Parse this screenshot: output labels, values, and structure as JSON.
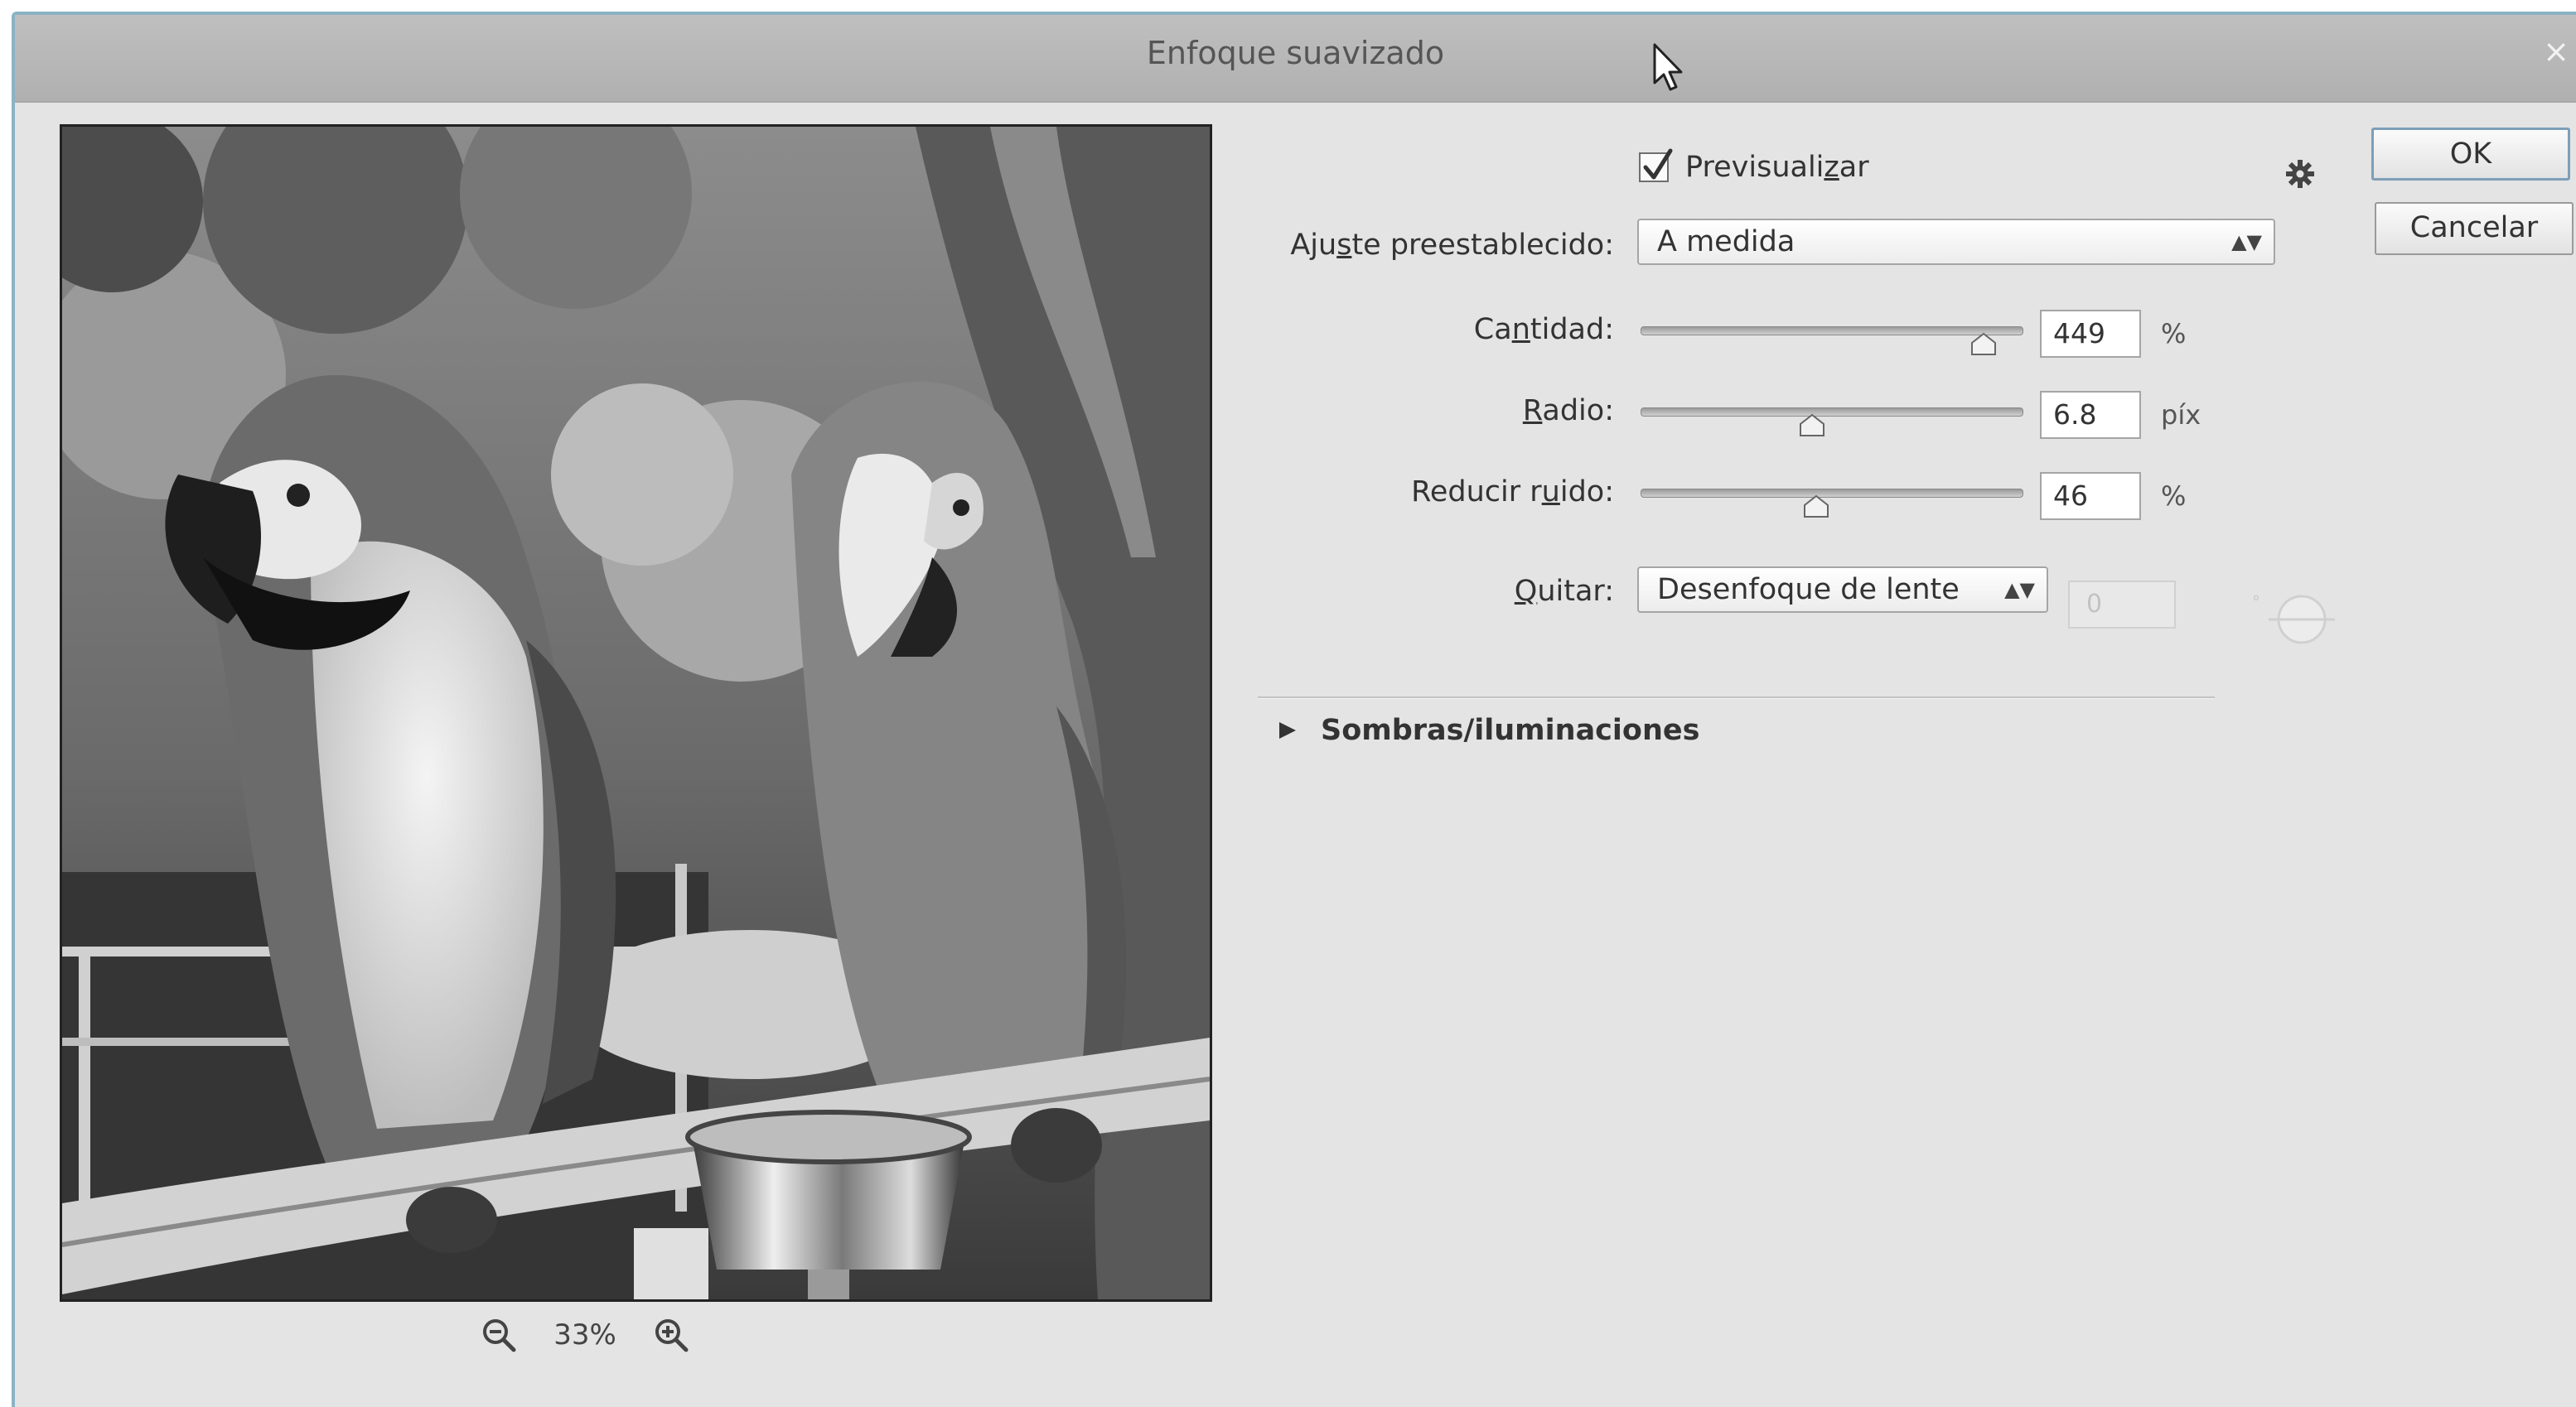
{
  "window": {
    "title": "Enfoque suavizado",
    "close_glyph": "×"
  },
  "preview": {
    "zoom_value": "33%",
    "zoom_out_icon": "zoom-out-magnifier-icon",
    "zoom_in_icon": "zoom-in-magnifier-icon"
  },
  "preview_checkbox": {
    "label_pre": "Previsuali",
    "label_u": "z",
    "label_post": "ar",
    "checked": true
  },
  "preset": {
    "label_pre": "Aju",
    "label_u": "s",
    "label_post": "te preestablecido:",
    "value": "A medida"
  },
  "amount": {
    "label_pre": "Ca",
    "label_u": "n",
    "label_post": "tidad:",
    "value": "449",
    "unit": "%",
    "slider_fraction": 0.9
  },
  "radius": {
    "label_pre": "",
    "label_u": "R",
    "label_post": "adio:",
    "value": "6.8",
    "unit": "píx",
    "slider_fraction": 0.45
  },
  "noise": {
    "label_pre": "Reducir r",
    "label_u": "u",
    "label_post": "ido:",
    "value": "46",
    "unit": "%",
    "slider_fraction": 0.46
  },
  "remove": {
    "label_pre": "",
    "label_u": "Q",
    "label_post": "uitar:",
    "value": "Desenfoque de lente",
    "angle_value": "0"
  },
  "shadows_section": {
    "label": "Sombras/iluminaciones",
    "expanded": false
  },
  "buttons": {
    "ok": "OK",
    "cancel": "Cancelar"
  },
  "colors": {
    "dialog_bg": "#e4e4e4",
    "titlebar": "#b5b5b5",
    "default_button_border": "#7d9fb8"
  }
}
